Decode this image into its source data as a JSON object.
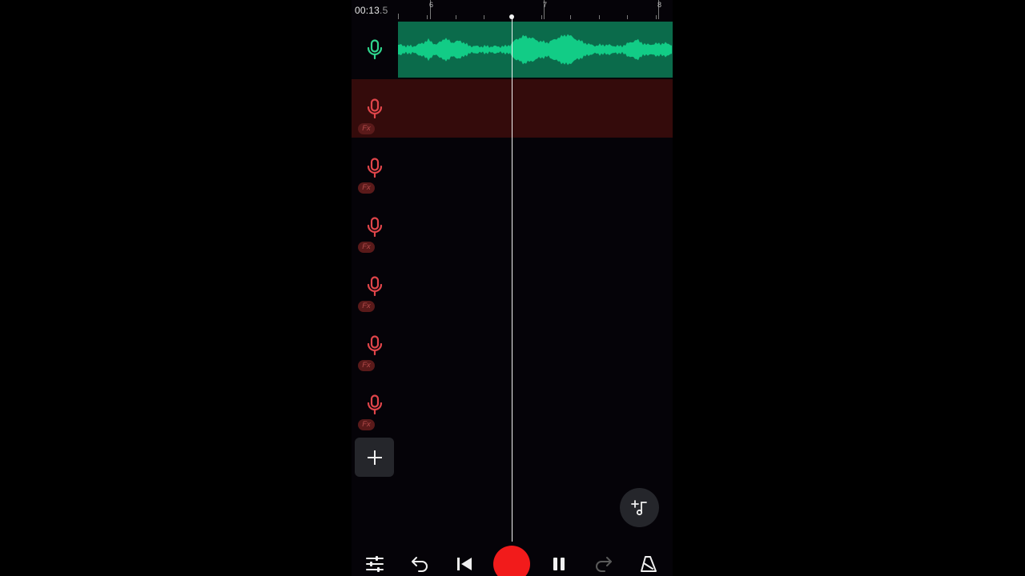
{
  "timeline": {
    "time_main": "00:13",
    "time_fraction": ".5",
    "ruler_labels": [
      "6",
      "7",
      "8"
    ]
  },
  "tracks": [
    {
      "state": "recorded",
      "icon": "microphone-icon",
      "color": "#2fd48c",
      "fx": null
    },
    {
      "state": "armed",
      "icon": "microphone-icon",
      "color": "#e0454a",
      "fx": "Fx"
    },
    {
      "state": "empty",
      "icon": "microphone-icon",
      "color": "#e0454a",
      "fx": "Fx"
    },
    {
      "state": "empty",
      "icon": "microphone-icon",
      "color": "#e0454a",
      "fx": "Fx"
    },
    {
      "state": "empty",
      "icon": "microphone-icon",
      "color": "#e0454a",
      "fx": "Fx"
    },
    {
      "state": "empty",
      "icon": "microphone-icon",
      "color": "#e0454a",
      "fx": "Fx"
    },
    {
      "state": "empty",
      "icon": "microphone-icon",
      "color": "#e0454a",
      "fx": "Fx"
    }
  ],
  "toolbar": {
    "icons": [
      "mixer-icon",
      "undo-icon",
      "skip-to-start-icon",
      "record-button",
      "pause-icon",
      "redo-icon",
      "metronome-icon"
    ]
  },
  "colors": {
    "recorded_clip_bg": "#0b6b4b",
    "waveform": "#12cc86",
    "armed_track_bg": "#340b0b",
    "record": "#f21b1b"
  }
}
